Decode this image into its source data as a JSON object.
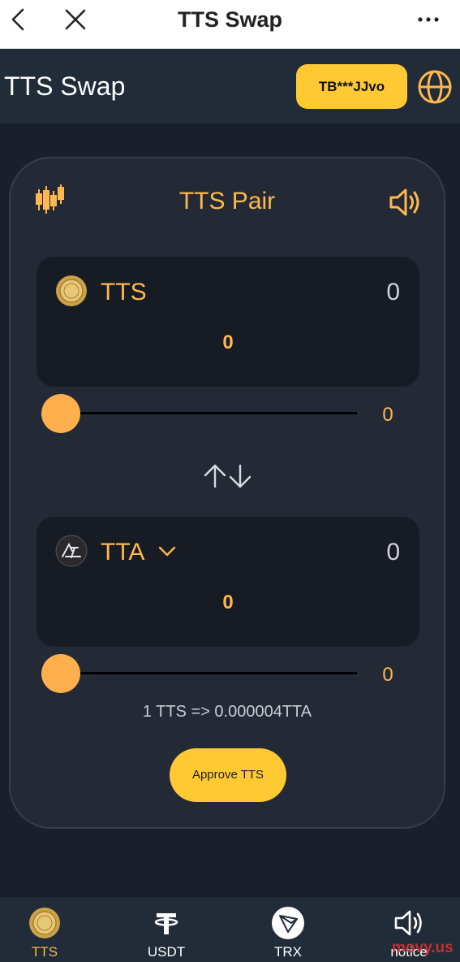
{
  "topbar": {
    "title": "TTS Swap"
  },
  "header": {
    "app_title": "TTS Swap",
    "wallet_address": "TB***JJvo"
  },
  "card": {
    "pair_title": "TTS Pair",
    "from": {
      "token": "TTS",
      "balance": "0",
      "amount": "0",
      "slider_value": "0",
      "slider_fraction": 0
    },
    "to": {
      "token": "TTA",
      "balance": "0",
      "amount": "0",
      "slider_value": "0",
      "slider_fraction": 0
    },
    "rate": "1 TTS => 0.000004TTA",
    "approve_label": "Approve TTS"
  },
  "nav": {
    "items": [
      {
        "label": "TTS",
        "icon": "tts-coin-icon",
        "active": true
      },
      {
        "label": "USDT",
        "icon": "tether-icon",
        "active": false
      },
      {
        "label": "TRX",
        "icon": "tron-icon",
        "active": false
      },
      {
        "label": "notice",
        "icon": "speaker-icon",
        "active": false
      }
    ]
  },
  "watermark": "movy.us",
  "colors": {
    "accent": "#ffb84d",
    "button": "#ffc933",
    "background": "#19202b",
    "card": "#232a36"
  }
}
